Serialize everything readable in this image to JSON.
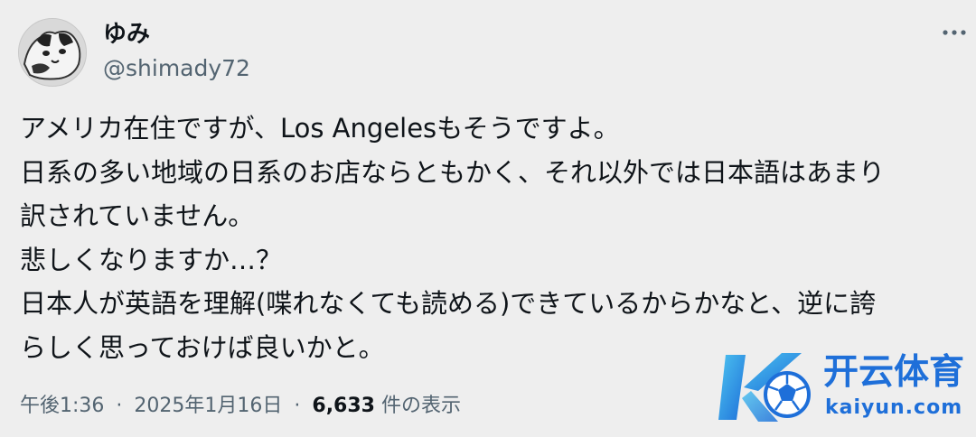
{
  "author": {
    "display_name": "ゆみ",
    "handle": "@shimady72"
  },
  "menu": {
    "icon": "more-horizontal-icon"
  },
  "tweet": {
    "lines": [
      "アメリカ在住ですが、Los Angelesもそうですよ。",
      "日系の多い地域の日系のお店ならともかく、それ以外では日本語はあまり",
      "訳されていません。",
      "悲しくなりますか…？",
      "日本人が英語を理解(喋れなくても読める)できているからかなと、逆に誇",
      "らしく思っておけば良いかと。"
    ]
  },
  "meta": {
    "time": "午後1:36",
    "separator": "·",
    "date": "2025年1月16日",
    "views_count": "6,633",
    "views_label": "件の表示"
  },
  "watermark": {
    "cn_text": "开云体育",
    "latin_text": "kaiyun.com"
  },
  "colors": {
    "background": "#eeeeee",
    "text_primary": "#0f1419",
    "text_secondary": "#536471",
    "watermark_blue": "#1e6fd9",
    "watermark_cyan": "#4cc3f0"
  }
}
